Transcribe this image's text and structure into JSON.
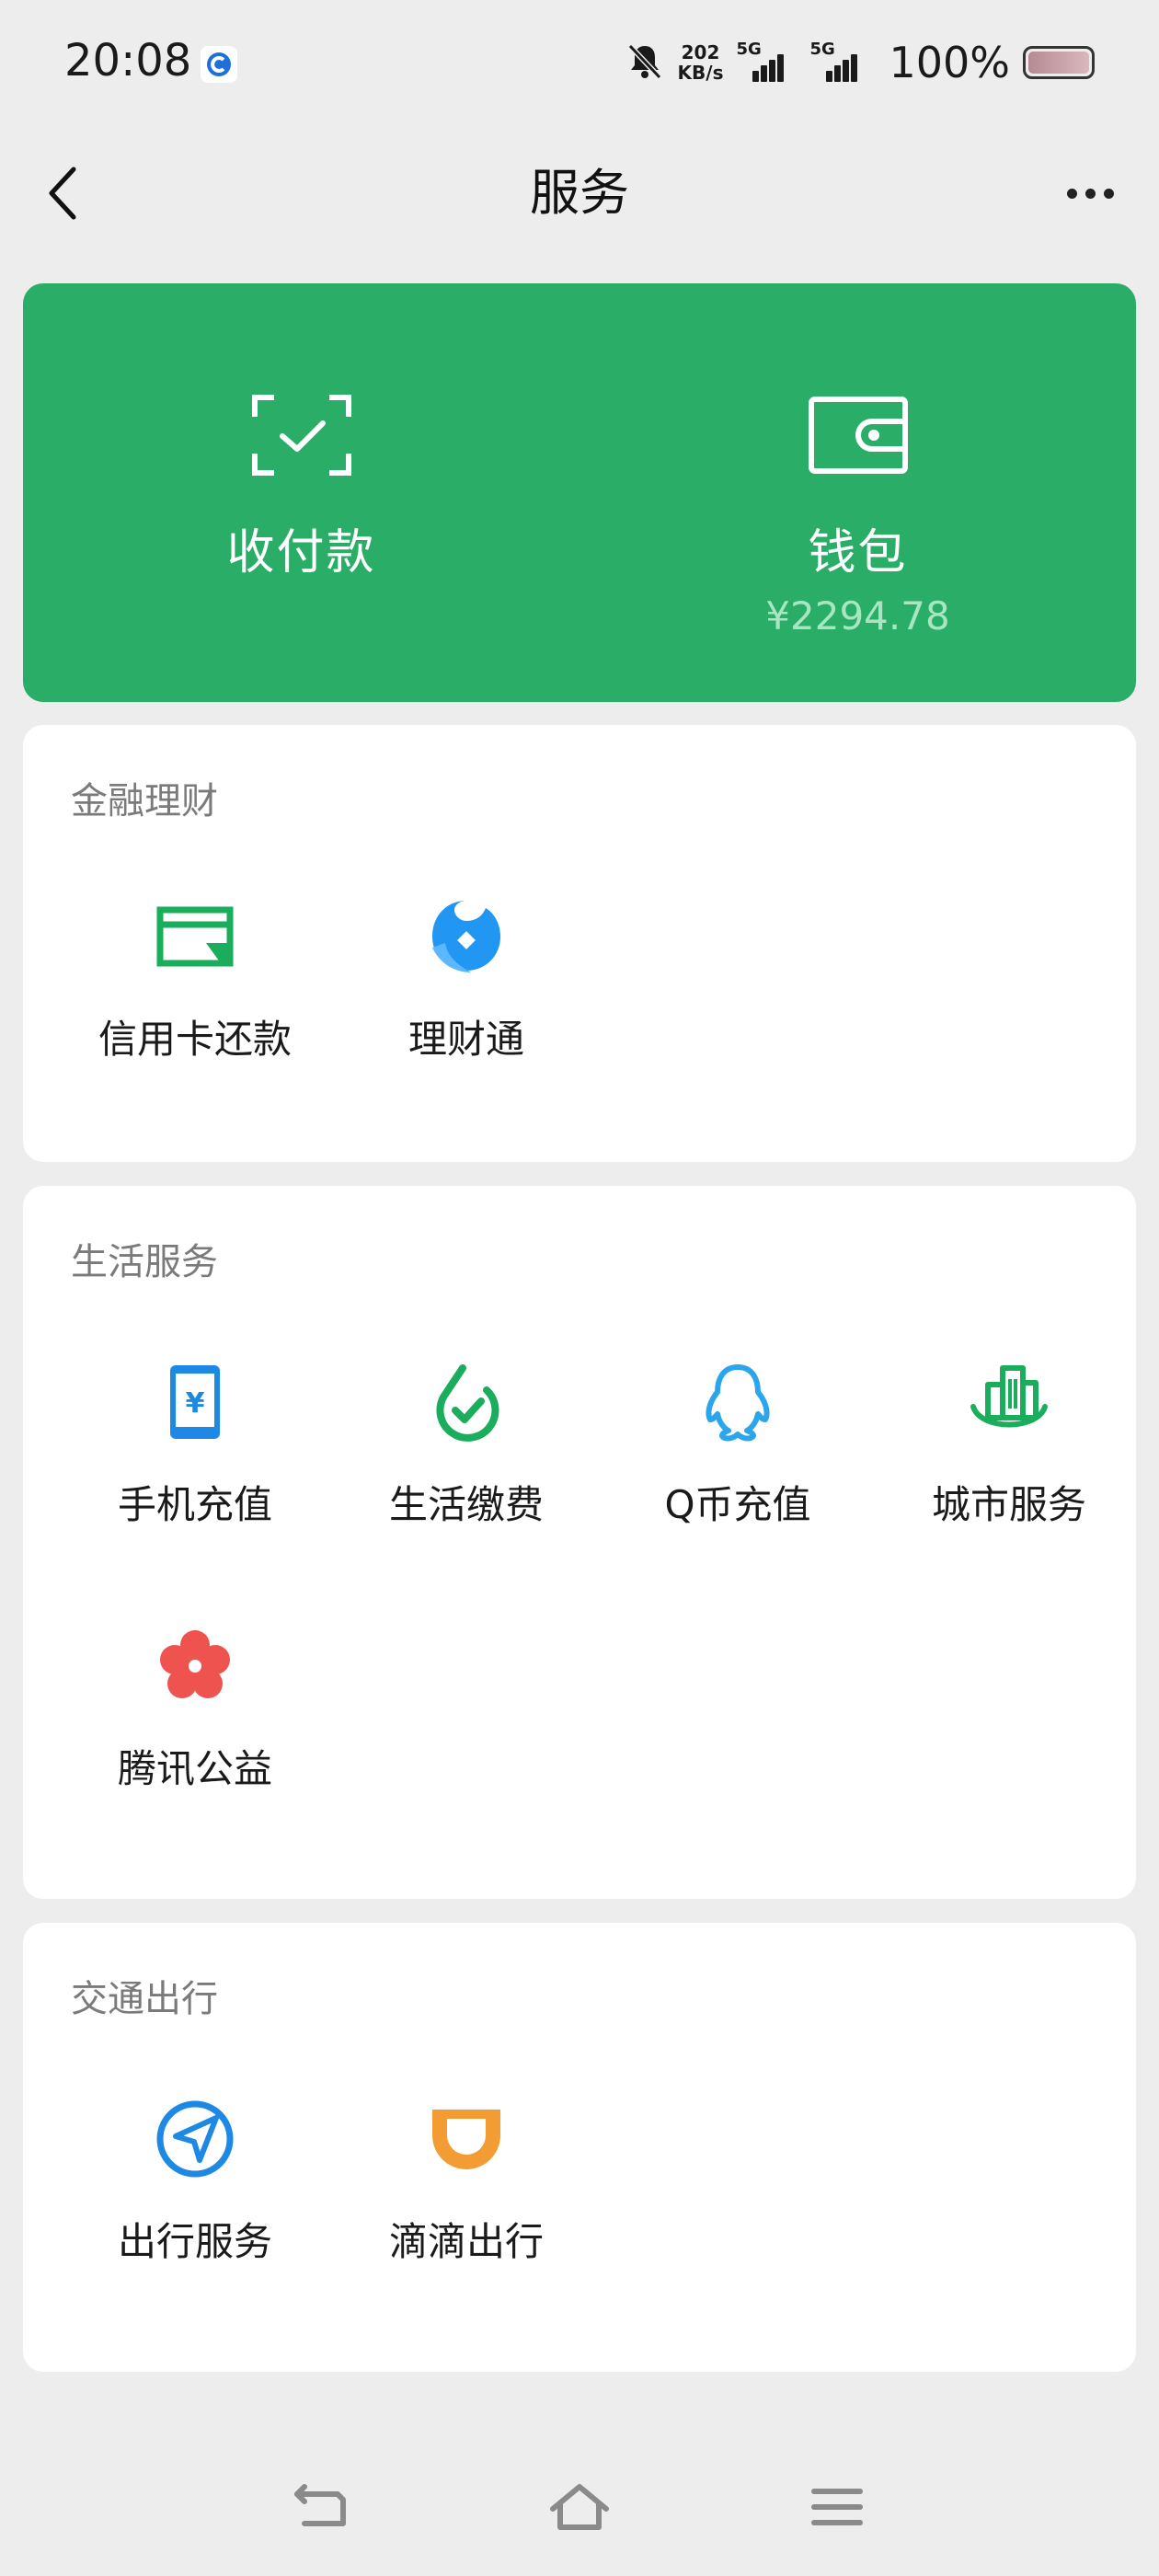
{
  "status_bar": {
    "time": "20:08",
    "net_speed_value": "202",
    "net_speed_unit": "KB/s",
    "signal1_label": "5G",
    "signal2_label": "5G",
    "battery": "100%"
  },
  "header": {
    "title": "服务"
  },
  "hero": {
    "pay": {
      "label": "收付款",
      "icon": "scan-check-icon"
    },
    "wallet": {
      "label": "钱包",
      "amount": "¥2294.78",
      "icon": "wallet-icon"
    }
  },
  "sections": {
    "finance": {
      "title": "金融理财",
      "items": [
        {
          "label": "信用卡还款",
          "icon": "credit-card-icon",
          "color": "#1aad5b"
        },
        {
          "label": "理财通",
          "icon": "wealth-icon",
          "color": "#2296f3"
        }
      ]
    },
    "life": {
      "title": "生活服务",
      "items": [
        {
          "label": "手机充值",
          "icon": "phone-topup-icon",
          "color": "#1e88e5"
        },
        {
          "label": "生活缴费",
          "icon": "bill-pay-icon",
          "color": "#1aad5b"
        },
        {
          "label": "Q币充值",
          "icon": "qq-penguin-icon",
          "color": "#2ba6ec"
        },
        {
          "label": "城市服务",
          "icon": "city-icon",
          "color": "#1aad5b"
        },
        {
          "label": "腾讯公益",
          "icon": "charity-flower-icon",
          "color": "#ef5350"
        }
      ]
    },
    "transport": {
      "title": "交通出行",
      "items": [
        {
          "label": "出行服务",
          "icon": "navigation-icon",
          "color": "#1e88e5"
        },
        {
          "label": "滴滴出行",
          "icon": "didi-icon",
          "color": "#f39c33"
        }
      ]
    }
  },
  "colors": {
    "hero_green": "#2aae67",
    "background": "#ededed"
  }
}
